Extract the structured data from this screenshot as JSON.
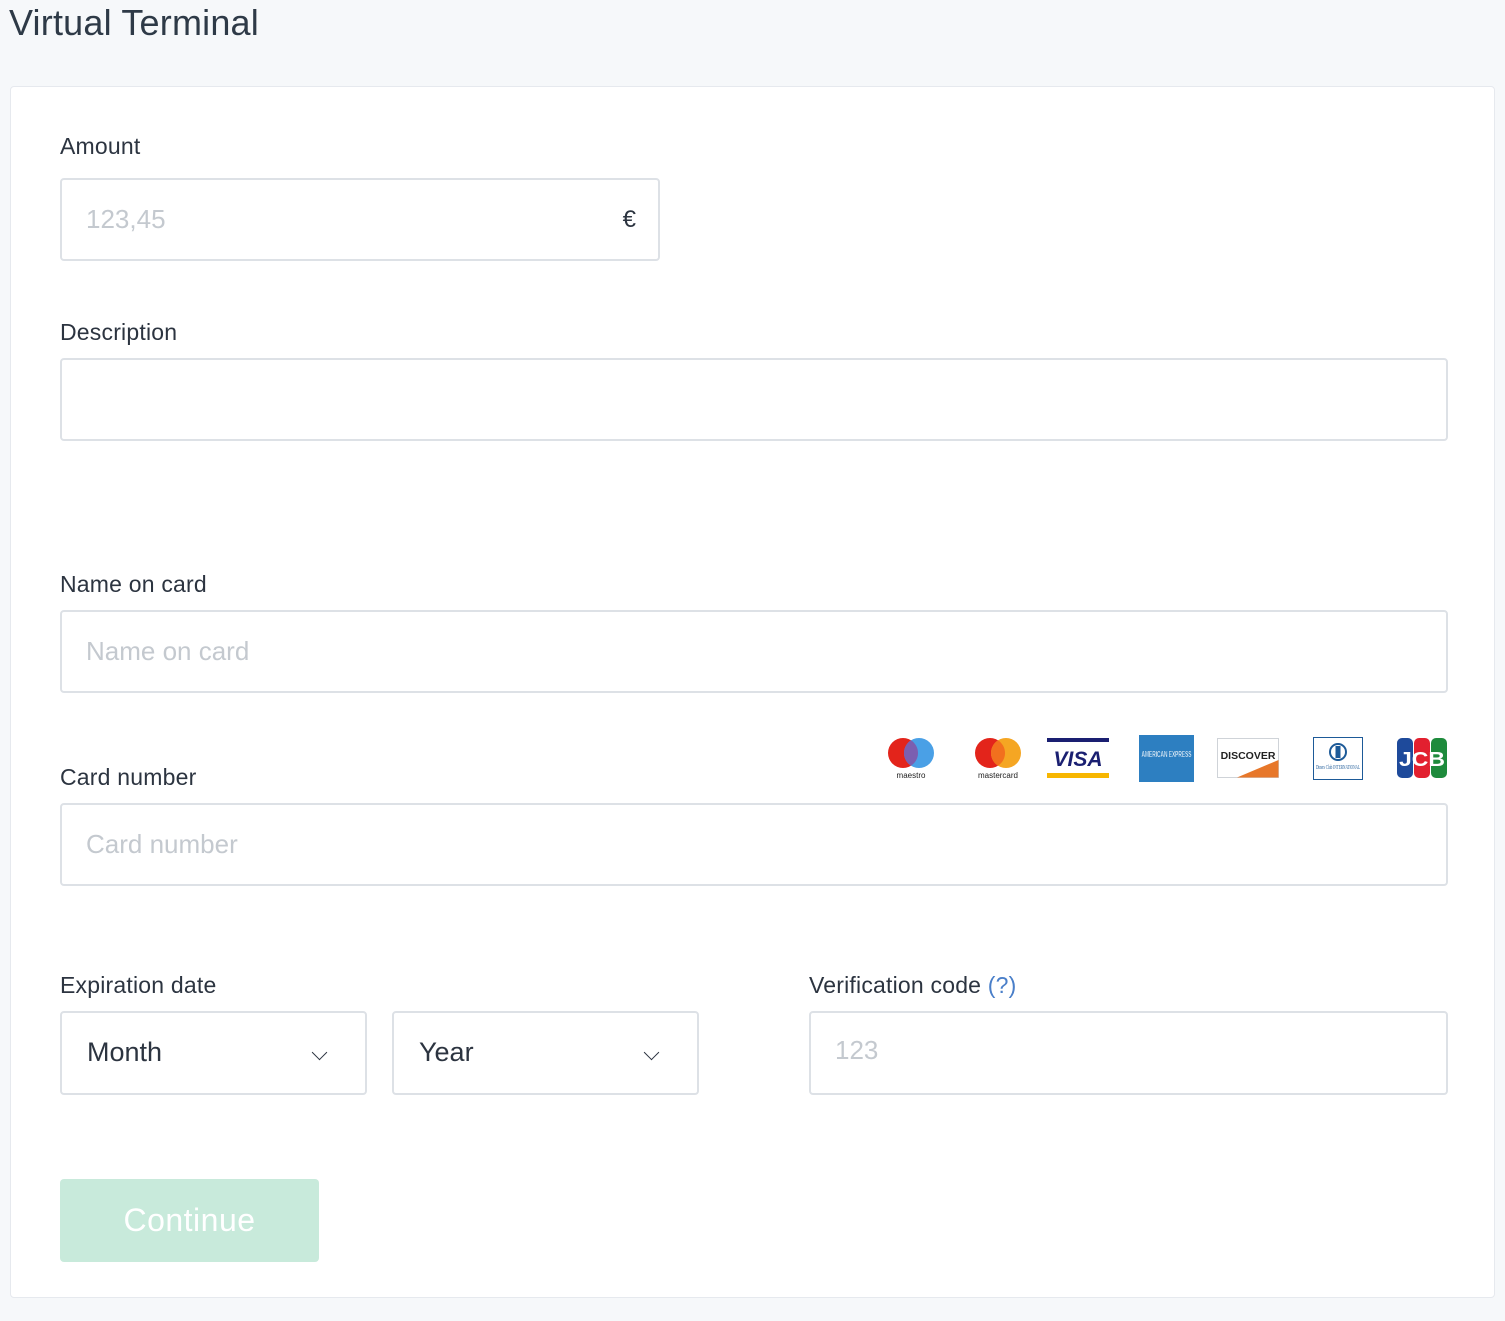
{
  "page": {
    "title": "Virtual Terminal"
  },
  "amount": {
    "label": "Amount",
    "placeholder": "123,45",
    "value": "",
    "currency": "€"
  },
  "description": {
    "label": "Description",
    "value": ""
  },
  "name_on_card": {
    "label": "Name on card",
    "placeholder": "Name on card",
    "value": ""
  },
  "card_number": {
    "label": "Card number",
    "placeholder": "Card number",
    "value": ""
  },
  "card_brands": [
    {
      "icon": "maestro-logo",
      "text": "maestro"
    },
    {
      "icon": "mastercard-logo",
      "text": "mastercard"
    },
    {
      "icon": "visa-logo",
      "text": "VISA"
    },
    {
      "icon": "american-express-logo",
      "text": "AMERICAN EXPRESS"
    },
    {
      "icon": "discover-logo",
      "text": "DISCOVER"
    },
    {
      "icon": "diners-club-logo",
      "text": "Diners Club INTERNATIONAL"
    },
    {
      "icon": "jcb-logo",
      "text": "JCB"
    }
  ],
  "expiration": {
    "label": "Expiration date",
    "month_value": "Month",
    "year_value": "Year"
  },
  "verification": {
    "label": "Verification code",
    "help": "(?)",
    "placeholder": "123",
    "value": ""
  },
  "actions": {
    "continue_label": "Continue"
  },
  "colors": {
    "background": "#f6f8fa",
    "text": "#2c3440",
    "placeholder": "#c4c9cf",
    "border": "#dde1e6",
    "link": "#4a7fc9",
    "button_disabled": "#c8eadb"
  }
}
